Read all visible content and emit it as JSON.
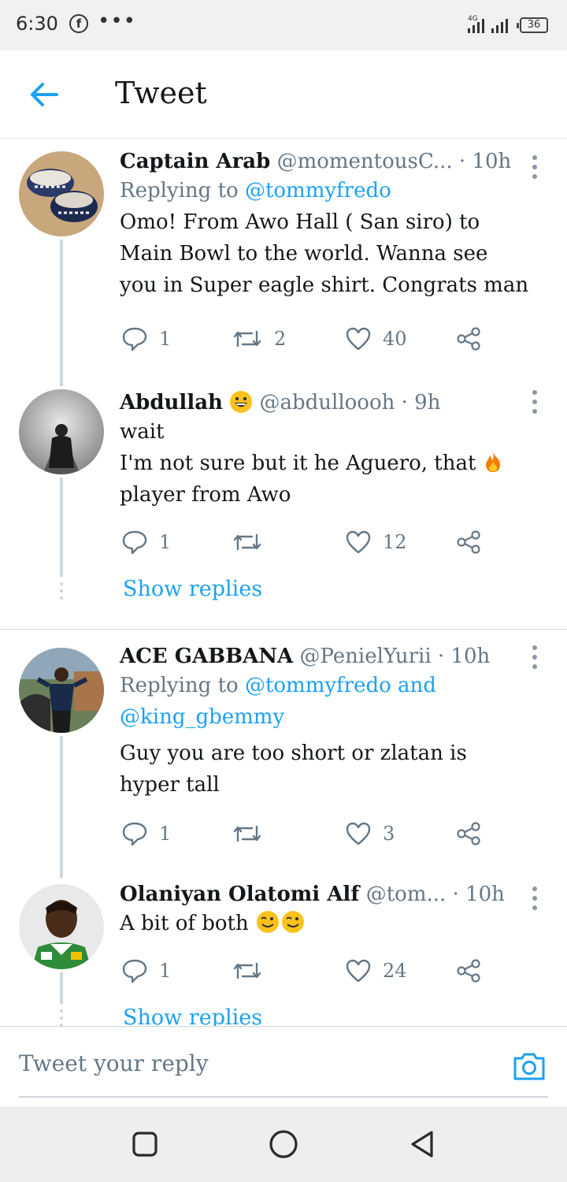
{
  "status_bar": {
    "time": "6:30",
    "more": "•••",
    "battery": "36"
  },
  "header": {
    "title": "Tweet"
  },
  "tweets": [
    {
      "name": "Captain Arab",
      "handle": "@momentousC...",
      "time": "· 10h",
      "reply_prefix": "Replying to",
      "reply_handles": "@tommyfredo",
      "text_lines": [
        "Omo! From Awo Hall ( San siro) to",
        "Main Bowl to the world. Wanna see",
        "you in Super eagle shirt. Congrats man"
      ],
      "replies": "1",
      "retweets": "2",
      "likes": "40"
    },
    {
      "name": "Abdullah",
      "handle": "@abdulloooh",
      "time": "· 9h",
      "text_lines": [
        "wait",
        "I'm not sure but it he Aguero, that",
        "player from Awo"
      ],
      "replies": "1",
      "retweets": "",
      "likes": "12",
      "show_replies": "Show replies"
    },
    {
      "name": "ACE GABBANA",
      "handle": "@PenielYurii",
      "time": "· 10h",
      "reply_prefix": "Replying to",
      "reply_handles_line1": "@tommyfredo and",
      "reply_handles_line2": "@king_gbemmy",
      "text_lines": [
        "Guy you are too short or zlatan is",
        "hyper tall"
      ],
      "replies": "1",
      "retweets": "",
      "likes": "3"
    },
    {
      "name": "Olaniyan Olatomi Alf",
      "handle": "@tom...",
      "time": "· 10h",
      "text_lines": [
        "A bit of both"
      ],
      "replies": "1",
      "retweets": "",
      "likes": "24",
      "show_replies": "Show replies"
    }
  ],
  "reply_bar": {
    "placeholder": "Tweet your reply"
  },
  "colors": {
    "accent": "#1da1f2",
    "muted": "#657786",
    "thread": "#ccd6dd"
  }
}
